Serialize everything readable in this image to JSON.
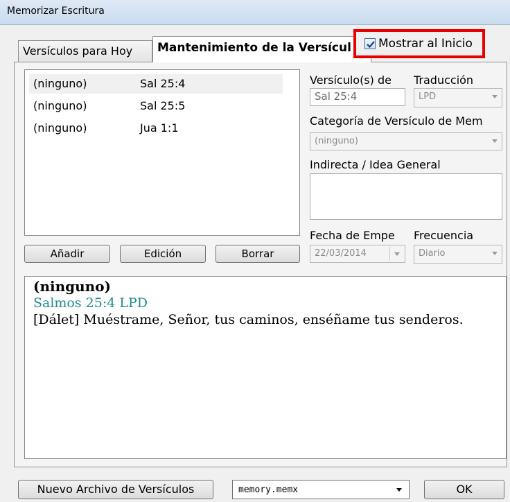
{
  "window": {
    "title": "Memorizar Escritura"
  },
  "tabs": [
    {
      "label": "Versículos para Hoy",
      "active": false
    },
    {
      "label": "Mantenimiento de la Versícul",
      "active": true
    }
  ],
  "show_on_start": {
    "label": "Mostrar al Inicio",
    "checked": true
  },
  "verse_list": [
    {
      "category": "(ninguno)",
      "reference": "Sal 25:4",
      "selected": true
    },
    {
      "category": "(ninguno)",
      "reference": "Sal 25:5",
      "selected": false
    },
    {
      "category": "(ninguno)",
      "reference": "Jua 1:1",
      "selected": false
    }
  ],
  "buttons": {
    "add": "Añadir",
    "edit": "Edición",
    "delete": "Borrar"
  },
  "form": {
    "verse_label": "Versículo(s) de",
    "verse_value": "Sal 25:4",
    "translation_label": "Traducción",
    "translation_value": "LPD",
    "category_label": "Categoría de Versículo de Mem",
    "category_value": "(ninguno)",
    "hint_label": "Indirecta / Idea General",
    "hint_value": "",
    "start_date_label": "Fecha de Empe",
    "start_date_value": "22/03/2014",
    "frequency_label": "Frecuencia",
    "frequency_value": "Diario"
  },
  "viewer": {
    "category": "(ninguno)",
    "reference": "Salmos 25:4 LPD",
    "text": "[Dálet] Muéstrame, Señor, tus caminos, enséñame tus senderos."
  },
  "footer": {
    "new_file_label": "Nuevo Archivo de Versículos",
    "file_value": "memory.memx",
    "ok_label": "OK"
  },
  "colors": {
    "highlight_border": "#e80000",
    "reference_text": "#1e8c88"
  }
}
